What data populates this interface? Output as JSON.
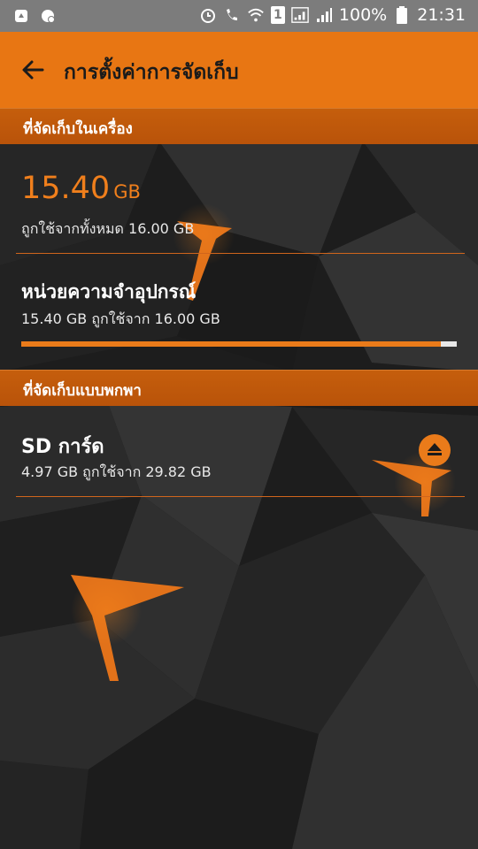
{
  "status_bar": {
    "battery": "100%",
    "time": "21:31",
    "sim_slot": "1",
    "icons": [
      "recycle-icon",
      "chat-icon",
      "alarm-icon",
      "wifi-call-icon",
      "wifi-icon",
      "sim-icon",
      "signal-icon",
      "signal-icon",
      "battery-icon"
    ]
  },
  "header": {
    "title": "การตั้งค่าการจัดเก็บ",
    "back_icon": "arrow-left-icon"
  },
  "internal": {
    "section_label": "ที่จัดเก็บในเครื่อง",
    "used_value": "15.40",
    "used_unit": "GB",
    "used_of_total": "ถูกใช้จากทั้งหมด 16.00 GB",
    "memory": {
      "label": "หน่วยความจำอุปกรณ์",
      "detail": "15.40 GB ถูกใช้จาก 16.00 GB",
      "usage_fraction": 0.9625
    }
  },
  "portable": {
    "section_label": "ที่จัดเก็บแบบพกพา",
    "sd": {
      "label": "SD การ์ด",
      "detail": "4.97 GB ถูกใช้จาก 29.82 GB",
      "action_icon": "eject-icon"
    }
  },
  "colors": {
    "accent": "#e87613",
    "section_bg": "#bf580b",
    "status_bg": "#7c7c7c",
    "highlight_text": "#f07f1c"
  }
}
